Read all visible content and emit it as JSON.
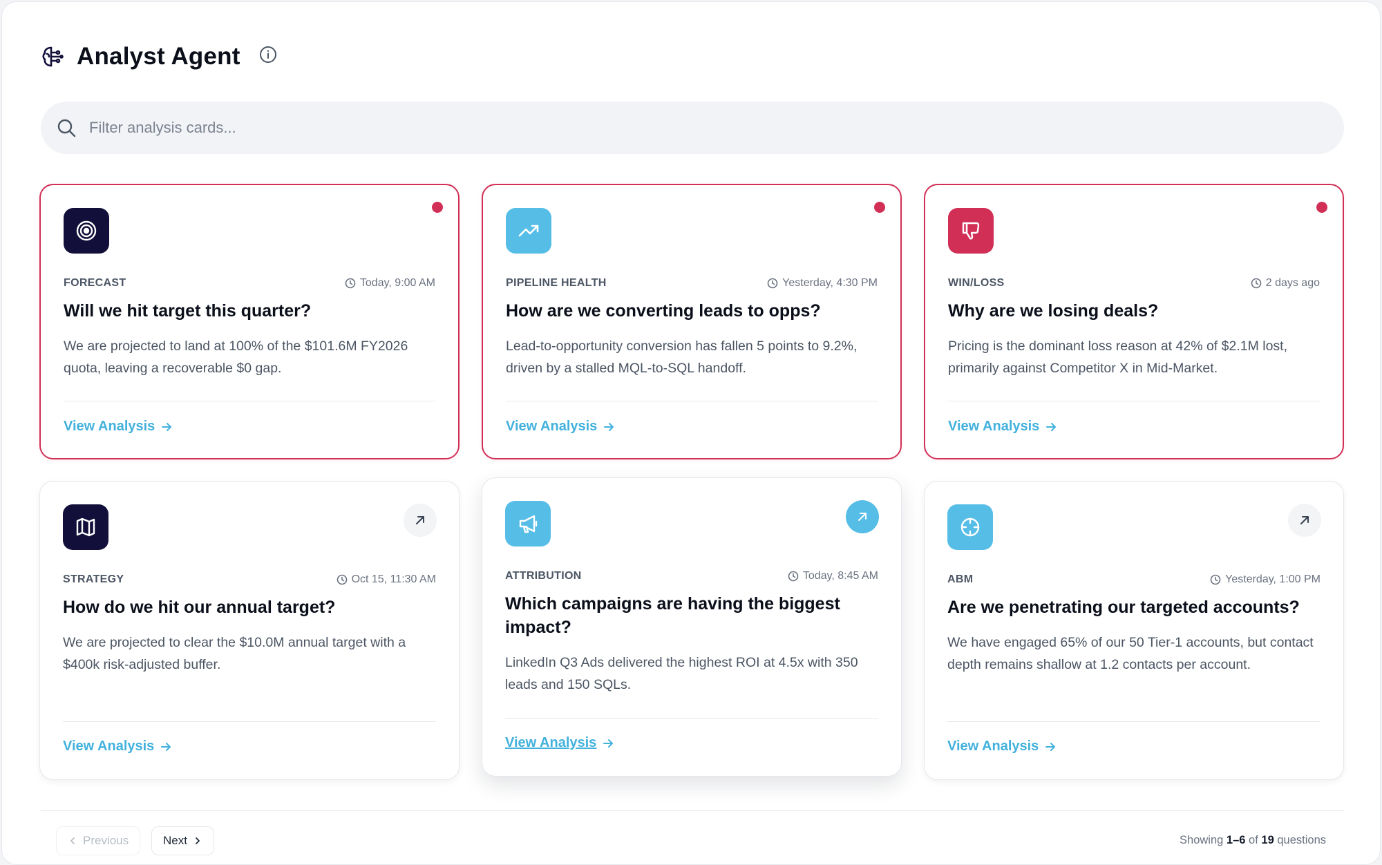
{
  "header": {
    "title": "Analyst Agent"
  },
  "search": {
    "placeholder": "Filter analysis cards..."
  },
  "colors": {
    "alert": "#d22f57",
    "navy": "#12103a",
    "sky": "#56bde6",
    "link": "#42b1dc"
  },
  "cards": [
    {
      "category": "FORECAST",
      "time": "Today, 9:00 AM",
      "title": "Will we hit target this quarter?",
      "description": "We are projected to land at 100% of the $101.6M FY2026 quota, leaving a recoverable $0 gap.",
      "link": "View Analysis",
      "icon": "target-icon",
      "icon_color": "#12103a",
      "status": "new-alert"
    },
    {
      "category": "PIPELINE HEALTH",
      "time": "Yesterday, 4:30 PM",
      "title": "How are we converting leads to opps?",
      "description": "Lead-to-opportunity conversion has fallen 5 points to 9.2%, driven by a stalled MQL-to-SQL handoff.",
      "link": "View Analysis",
      "icon": "trending-up-icon",
      "icon_color": "#56bde6",
      "status": "new-alert"
    },
    {
      "category": "WIN/LOSS",
      "time": "2 days ago",
      "title": "Why are we losing deals?",
      "description": "Pricing is the dominant loss reason at 42% of $2.1M lost, primarily against Competitor X in Mid-Market.",
      "link": "View Analysis",
      "icon": "thumbs-down-icon",
      "icon_color": "#d22f57",
      "status": "new-alert"
    },
    {
      "category": "STRATEGY",
      "time": "Oct 15, 11:30 AM",
      "title": "How do we hit our annual target?",
      "description": "We are projected to clear the $10.0M annual target with a $400k risk-adjusted buffer.",
      "link": "View Analysis",
      "icon": "map-icon",
      "icon_color": "#12103a",
      "status": "open"
    },
    {
      "category": "ATTRIBUTION",
      "time": "Today, 8:45 AM",
      "title": "Which campaigns are having the biggest impact?",
      "description": "LinkedIn Q3 Ads delivered the highest ROI at 4.5x with 350 leads and 150 SQLs.",
      "link": "View Analysis",
      "icon": "megaphone-icon",
      "icon_color": "#56bde6",
      "status": "hovered"
    },
    {
      "category": "ABM",
      "time": "Yesterday, 1:00 PM",
      "title": "Are we penetrating our targeted accounts?",
      "description": "We have engaged 65% of our 50 Tier-1 accounts, but contact depth remains shallow at 1.2 contacts per account.",
      "link": "View Analysis",
      "icon": "crosshair-icon",
      "icon_color": "#56bde6",
      "status": "open"
    }
  ],
  "pagination": {
    "previous": "Previous",
    "next": "Next",
    "showing_prefix": "Showing",
    "range": "1–6",
    "of": "of",
    "total": "19",
    "suffix": "questions"
  }
}
